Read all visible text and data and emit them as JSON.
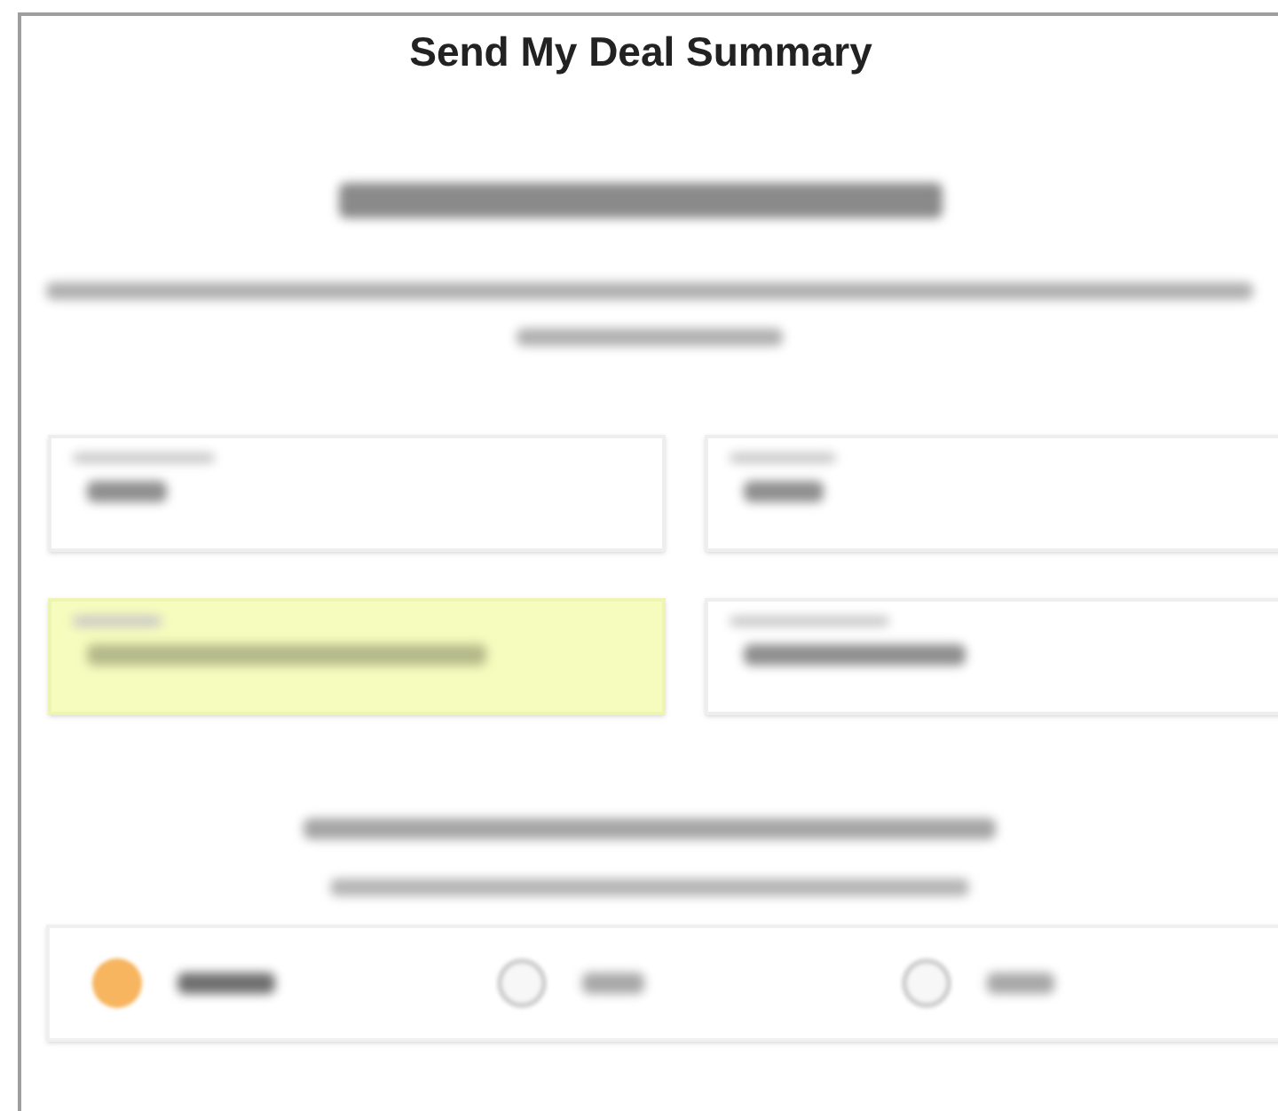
{
  "title": "Send My Deal Summary",
  "fields": [
    {
      "autofilled": false
    },
    {
      "autofilled": false
    },
    {
      "autofilled": true
    },
    {
      "autofilled": false
    }
  ],
  "contact_options": [
    {
      "selected": true
    },
    {
      "selected": false
    },
    {
      "selected": false
    }
  ]
}
